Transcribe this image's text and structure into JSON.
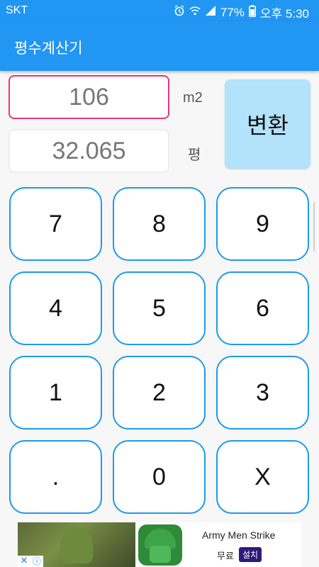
{
  "status_bar": {
    "carrier": "SKT",
    "battery": "77%",
    "time": "오후 5:30",
    "icons": [
      "alarm-icon",
      "wifi-icon",
      "signal-icon",
      "battery-icon"
    ]
  },
  "app_bar": {
    "title": "평수계산기"
  },
  "inputs": {
    "square_meters": {
      "value": "106",
      "unit": "m2"
    },
    "pyeong": {
      "value": "32.065",
      "unit": "평"
    }
  },
  "convert_button": {
    "label": "변환"
  },
  "keypad": [
    [
      "7",
      "8",
      "9"
    ],
    [
      "4",
      "5",
      "6"
    ],
    [
      "1",
      "2",
      "3"
    ],
    [
      ".",
      "0",
      "X"
    ]
  ],
  "ad": {
    "app_name": "Army Men Strike",
    "price": "무료",
    "install_label": "설치",
    "close_symbol": "✕",
    "info_symbol": "ⓘ"
  },
  "colors": {
    "primary": "#2196f3",
    "active_border": "#e9367a",
    "key_border": "#1e9be8",
    "convert_bg": "#b3e2fb"
  }
}
